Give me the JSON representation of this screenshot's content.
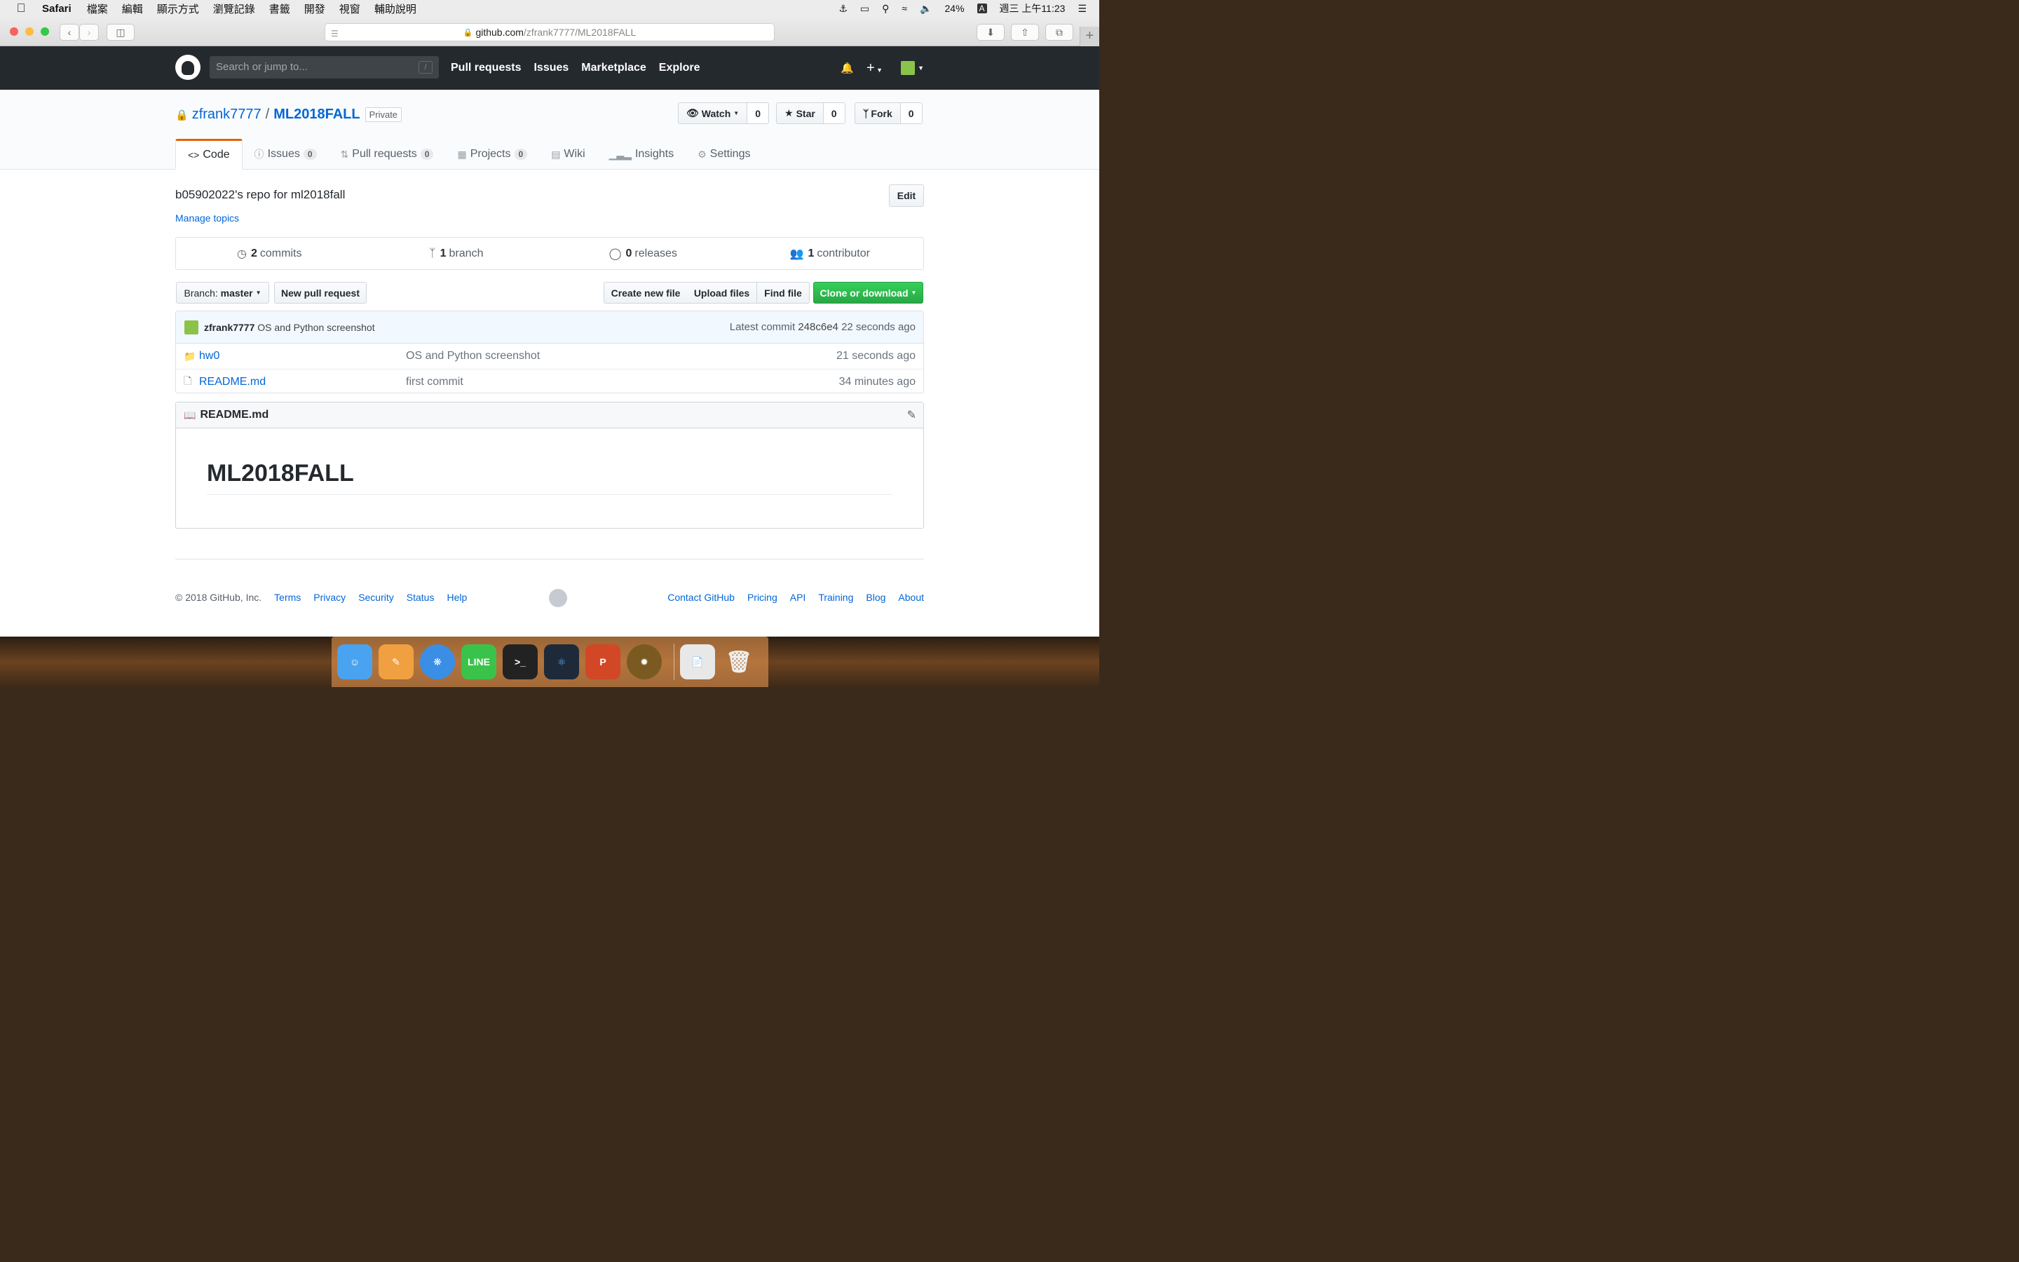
{
  "menubar": {
    "app": "Safari",
    "items": [
      "檔案",
      "編輯",
      "顯示方式",
      "瀏覽記錄",
      "書籤",
      "開發",
      "視窗",
      "輔助說明"
    ],
    "battery": "24%",
    "input_method": "A",
    "clock": "週三 上午11:23"
  },
  "browser": {
    "url_host": "github.com",
    "url_path": "/zfrank7777/ML2018FALL"
  },
  "gh_header": {
    "search_placeholder": "Search or jump to...",
    "search_shortcut": "/",
    "nav": [
      "Pull requests",
      "Issues",
      "Marketplace",
      "Explore"
    ]
  },
  "repo": {
    "owner": "zfrank7777",
    "name": "ML2018FALL",
    "visibility": "Private",
    "watch": {
      "label": "Watch",
      "count": "0"
    },
    "star": {
      "label": "Star",
      "count": "0"
    },
    "fork": {
      "label": "Fork",
      "count": "0"
    },
    "tabs": [
      {
        "label": "Code",
        "count": ""
      },
      {
        "label": "Issues",
        "count": "0"
      },
      {
        "label": "Pull requests",
        "count": "0"
      },
      {
        "label": "Projects",
        "count": "0"
      },
      {
        "label": "Wiki",
        "count": ""
      },
      {
        "label": "Insights",
        "count": ""
      },
      {
        "label": "Settings",
        "count": ""
      }
    ],
    "description": "b05902022's repo for ml2018fall",
    "manage_topics": "Manage topics",
    "edit": "Edit"
  },
  "summary": {
    "commits": {
      "num": "2",
      "label": "commits"
    },
    "branches": {
      "num": "1",
      "label": "branch"
    },
    "releases": {
      "num": "0",
      "label": "releases"
    },
    "contributors": {
      "num": "1",
      "label": "contributor"
    }
  },
  "actions": {
    "branch_prefix": "Branch:",
    "branch": "master",
    "new_pr": "New pull request",
    "create_file": "Create new file",
    "upload": "Upload files",
    "find": "Find file",
    "clone": "Clone or download"
  },
  "latest_commit": {
    "author": "zfrank7777",
    "message": "OS and Python screenshot",
    "label": "Latest commit",
    "sha": "248c6e4",
    "age": "22 seconds ago"
  },
  "files": [
    {
      "name": "hw0",
      "type": "folder",
      "message": "OS and Python screenshot",
      "age": "21 seconds ago"
    },
    {
      "name": "README.md",
      "type": "file",
      "message": "first commit",
      "age": "34 minutes ago"
    }
  ],
  "readme": {
    "filename": "README.md",
    "heading": "ML2018FALL"
  },
  "footer": {
    "copyright": "© 2018 GitHub, Inc.",
    "left_links": [
      "Terms",
      "Privacy",
      "Security",
      "Status",
      "Help"
    ],
    "right_links": [
      "Contact GitHub",
      "Pricing",
      "API",
      "Training",
      "Blog",
      "About"
    ]
  },
  "dock": {
    "apps": [
      {
        "name": "Finder",
        "color": "#4aa3f0"
      },
      {
        "name": "Pages",
        "color": "#f0a040"
      },
      {
        "name": "Safari",
        "color": "#3a8ee6"
      },
      {
        "name": "LINE",
        "color": "#3ac34a",
        "label": "LINE"
      },
      {
        "name": "Terminal",
        "color": "#222222",
        "label": ">_"
      },
      {
        "name": "Atom",
        "color": "#1e2a3a"
      },
      {
        "name": "PowerPoint",
        "color": "#d24726",
        "label": "P"
      },
      {
        "name": "Hearthstone",
        "color": "#7a5a20"
      }
    ]
  }
}
